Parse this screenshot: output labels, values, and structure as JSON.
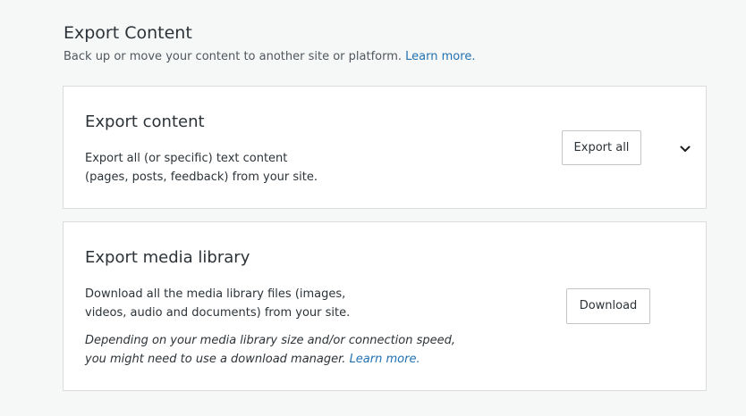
{
  "header": {
    "title": "Export Content",
    "subtitle": "Back up or move your content to another site or platform.",
    "learn_more": "Learn more."
  },
  "export_content_card": {
    "title": "Export content",
    "description_line1": "Export all (or specific) text content",
    "description_line2": "(pages, posts, feedback) from your site.",
    "button_label": "Export all",
    "expand_icon": "chevron-down-icon"
  },
  "export_media_card": {
    "title": "Export media library",
    "description_line1": "Download all the media library files (images,",
    "description_line2": "videos, audio and documents) from your site.",
    "note_line1": "Depending on your media library size and/or connection speed,",
    "note_line2": "you might need to use a download manager.",
    "note_link": "Learn more.",
    "button_label": "Download"
  },
  "colors": {
    "background": "#f6f7f7",
    "card": "#ffffff",
    "link": "#2271b1",
    "border": "#dcdcde"
  }
}
